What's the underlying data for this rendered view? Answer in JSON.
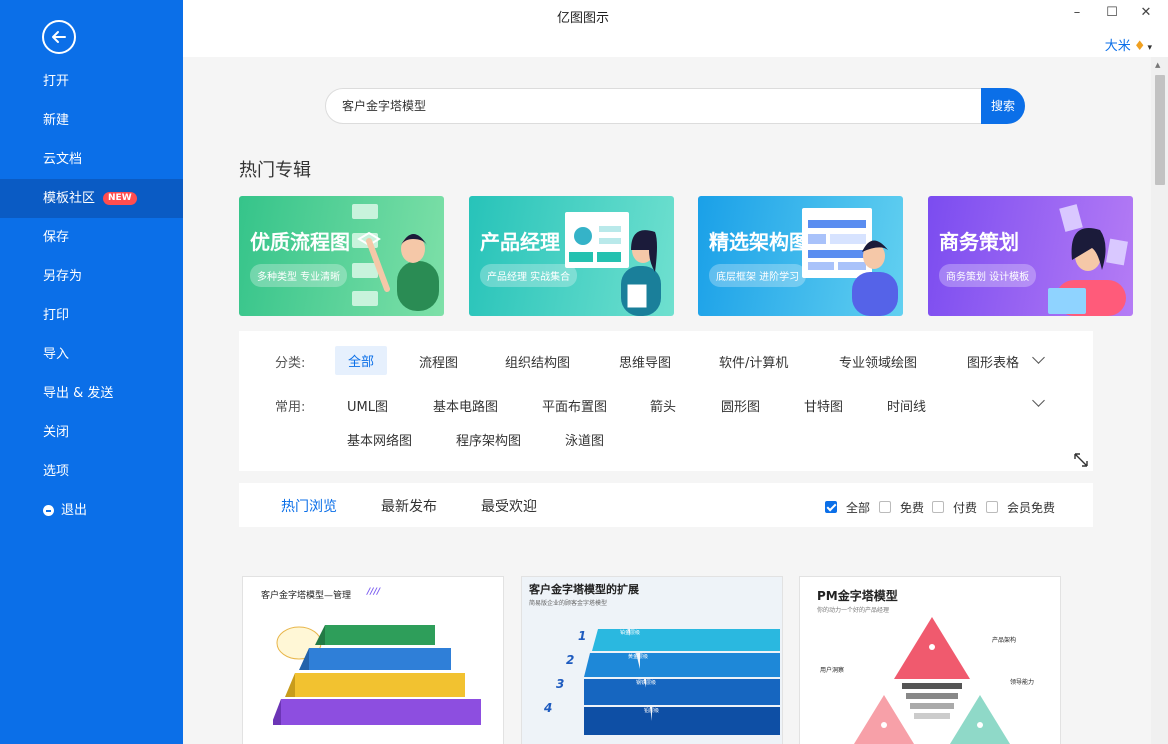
{
  "window": {
    "title": "亿图图示",
    "minimize": "–",
    "maximize": "☐",
    "close": "✕"
  },
  "user": {
    "name": "大米",
    "gem_icon": "diamond-icon",
    "caret": "▾"
  },
  "sidebar": {
    "items": [
      {
        "label": "打开"
      },
      {
        "label": "新建"
      },
      {
        "label": "云文档"
      },
      {
        "label": "模板社区",
        "badge": "NEW",
        "active": true
      },
      {
        "label": "保存"
      },
      {
        "label": "另存为"
      },
      {
        "label": "打印"
      },
      {
        "label": "导入"
      },
      {
        "label": "导出 & 发送"
      },
      {
        "label": "关闭"
      },
      {
        "label": "选项"
      },
      {
        "label": "退出"
      }
    ]
  },
  "search": {
    "value": "客户金字塔模型",
    "button": "搜索"
  },
  "featured": {
    "title": "热门专辑",
    "banners": [
      {
        "title": "优质流程图",
        "subtitle": "多种类型 专业清晰",
        "color_from": "#35c48a",
        "color_to": "#7ee0a8"
      },
      {
        "title": "产品经理",
        "subtitle": "产品经理 实战集合",
        "color_from": "#27c3b9",
        "color_to": "#6fe0cf"
      },
      {
        "title": "精选架构图",
        "subtitle": "底层框架 进阶学习",
        "color_from": "#1aa0e8",
        "color_to": "#62d0f0"
      },
      {
        "title": "商务策划",
        "subtitle": "商务策划 设计模板",
        "color_from": "#7b4cf0",
        "color_to": "#b57cf5"
      }
    ]
  },
  "filters": {
    "category_label": "分类:",
    "categories": [
      "全部",
      "流程图",
      "组织结构图",
      "思维导图",
      "软件/计算机",
      "专业领域绘图",
      "图形表格"
    ],
    "common_label": "常用:",
    "common": [
      "UML图",
      "基本电路图",
      "平面布置图",
      "箭头",
      "圆形图",
      "甘特图",
      "时间线",
      "基本网络图",
      "程序架构图",
      "泳道图"
    ]
  },
  "sort_tabs": [
    "热门浏览",
    "最新发布",
    "最受欢迎"
  ],
  "price_filters": [
    {
      "label": "全部",
      "checked": true
    },
    {
      "label": "免费",
      "checked": false
    },
    {
      "label": "付费",
      "checked": false
    },
    {
      "label": "会员免费",
      "checked": false
    }
  ],
  "templates": [
    {
      "title": "客户金字塔模型—管理",
      "slash": "////",
      "layers": [
        "",
        ""
      ]
    },
    {
      "title": "客户金字塔模型的扩展",
      "subtitle": "简易版企业的顾客金字塔模型",
      "steps": [
        "1",
        "2",
        "3",
        "4"
      ],
      "labels": [
        "铂金层级",
        "黄金层级",
        "钢铁层级",
        "铅层级"
      ]
    },
    {
      "title": "PM金字塔模型",
      "subtitle": "你的动力一个好的产品经理",
      "labels": [
        "产品架构",
        "用户洞察",
        "领导能力"
      ]
    }
  ],
  "colors": {
    "accent": "#0b6fe8",
    "badge": "#ff4d4f"
  }
}
